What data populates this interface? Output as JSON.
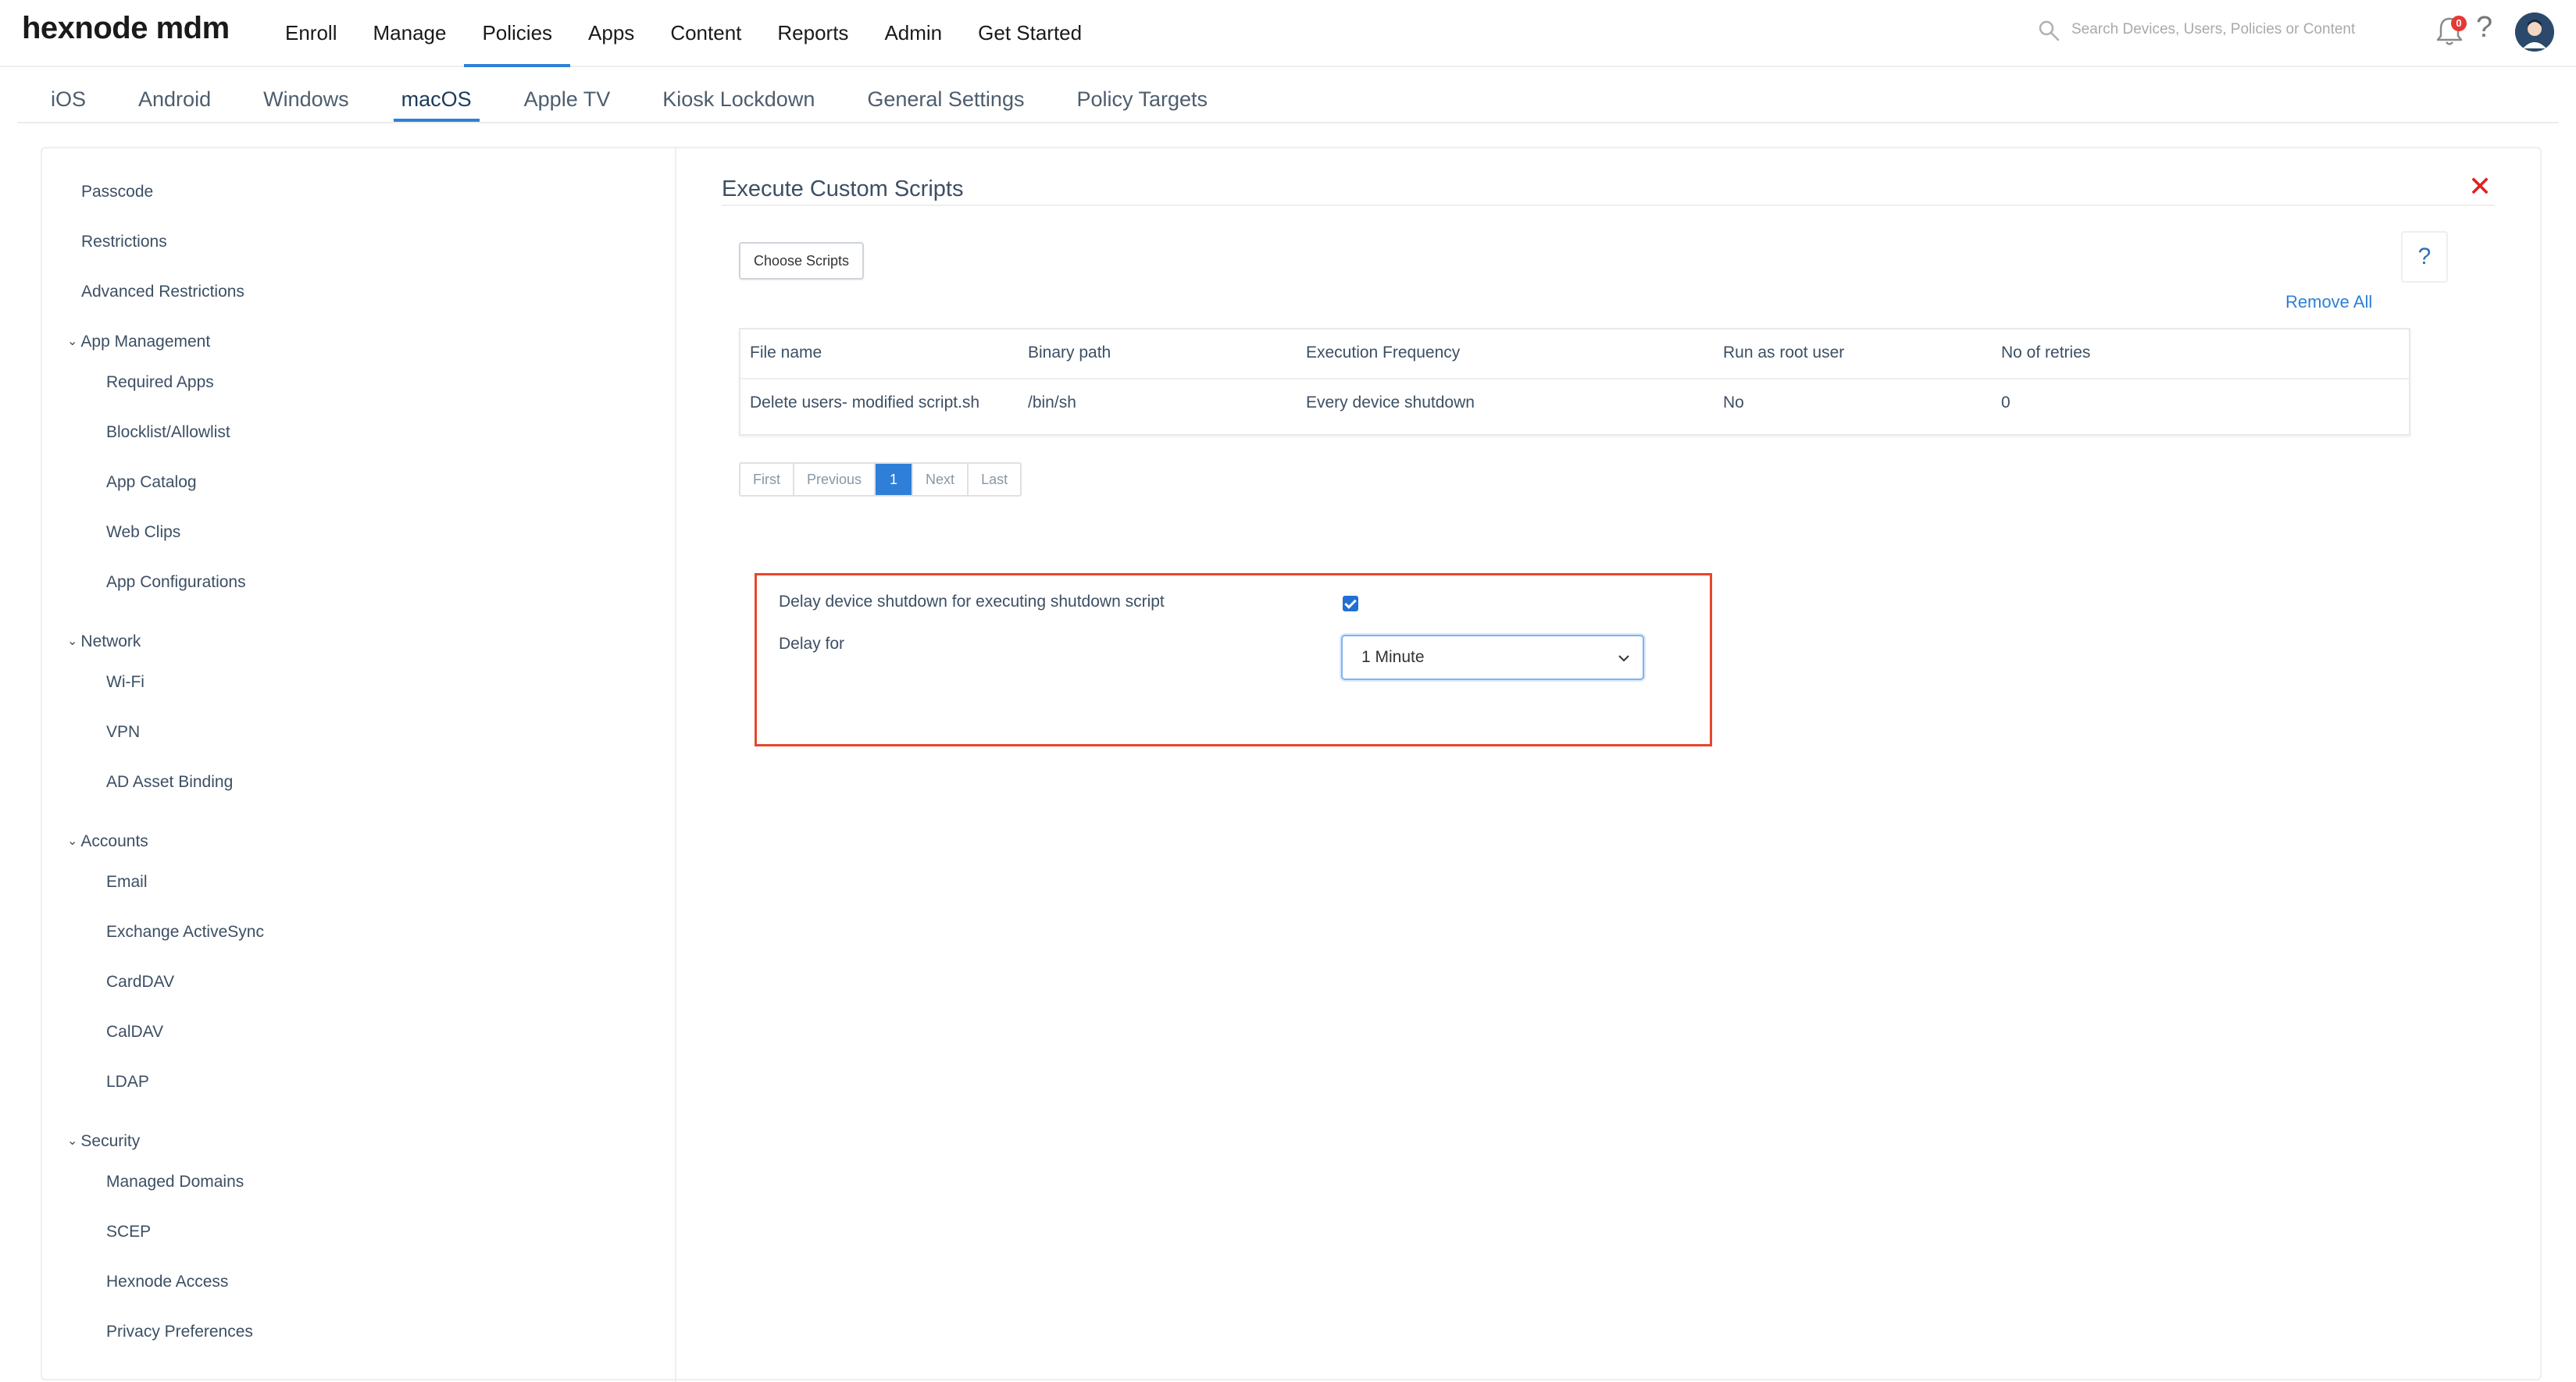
{
  "brand": "hexnode mdm",
  "topnav": {
    "items": [
      "Enroll",
      "Manage",
      "Policies",
      "Apps",
      "Content",
      "Reports",
      "Admin",
      "Get Started"
    ],
    "active": "Policies"
  },
  "search": {
    "placeholder": "Search Devices, Users, Policies or Content"
  },
  "notifications": {
    "count": "0"
  },
  "os_tabs": {
    "items": [
      "iOS",
      "Android",
      "Windows",
      "macOS",
      "Apple TV",
      "Kiosk Lockdown",
      "General Settings",
      "Policy Targets"
    ],
    "active": "macOS"
  },
  "sidebar": {
    "top_items": [
      "Passcode",
      "Restrictions",
      "Advanced Restrictions"
    ],
    "groups": [
      {
        "label": "App Management",
        "items": [
          "Required Apps",
          "Blocklist/Allowlist",
          "App Catalog",
          "Web Clips",
          "App Configurations"
        ]
      },
      {
        "label": "Network",
        "items": [
          "Wi-Fi",
          "VPN",
          "AD Asset Binding"
        ]
      },
      {
        "label": "Accounts",
        "items": [
          "Email",
          "Exchange ActiveSync",
          "CardDAV",
          "CalDAV",
          "LDAP"
        ]
      },
      {
        "label": "Security",
        "items": [
          "Managed Domains",
          "SCEP",
          "Hexnode Access",
          "Privacy Preferences"
        ]
      }
    ]
  },
  "panel": {
    "title": "Execute Custom Scripts",
    "choose_button": "Choose Scripts",
    "help": "?",
    "remove_all": "Remove All",
    "close": "✕"
  },
  "table": {
    "columns": [
      "File name",
      "Binary path",
      "Execution Frequency",
      "Run as root user",
      "No of retries"
    ],
    "rows": [
      [
        "Delete users- modified script.sh",
        "/bin/sh",
        "Every device shutdown",
        "No",
        "0"
      ]
    ]
  },
  "pagination": {
    "first": "First",
    "previous": "Previous",
    "current": "1",
    "next": "Next",
    "last": "Last"
  },
  "delay": {
    "checkbox_label": "Delay device shutdown for executing shutdown script",
    "checked": true,
    "delay_label": "Delay for",
    "delay_value": "1 Minute"
  },
  "colors": {
    "accent": "#2f7fd8",
    "highlight_border": "#e8452c",
    "close": "#e02020"
  }
}
